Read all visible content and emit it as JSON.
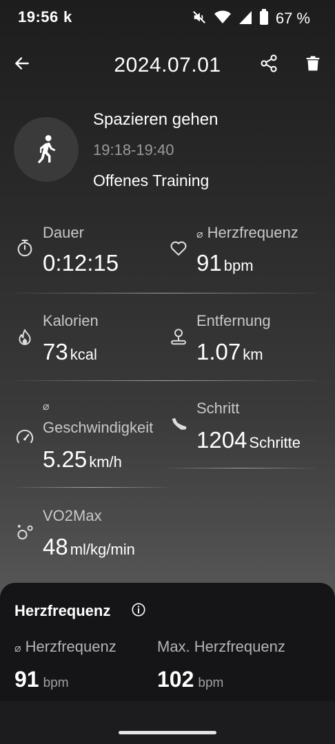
{
  "status": {
    "time": "19:56",
    "app_letter": "k",
    "battery_pct": "67 %"
  },
  "appbar": {
    "title": "2024.07.01"
  },
  "activity": {
    "name": "Spazieren gehen",
    "time_range": "19:18-19:40",
    "type": "Offenes Training"
  },
  "metrics": {
    "duration": {
      "label": "Dauer",
      "value": "0:12:15",
      "unit": ""
    },
    "avg_hr": {
      "label": "Herzfrequenz",
      "prefix": "⌀",
      "value": "91",
      "unit": "bpm"
    },
    "calories": {
      "label": "Kalorien",
      "value": "73",
      "unit": "kcal"
    },
    "distance": {
      "label": "Entfernung",
      "value": "1.07",
      "unit": "km"
    },
    "speed": {
      "prefix": "⌀",
      "label": "Geschwindigkeit",
      "value": "5.25",
      "unit": "km/h"
    },
    "steps": {
      "label": "Schritt",
      "value": "1204",
      "unit": "Schritte"
    },
    "vo2max": {
      "label": "VO2Max",
      "value": "48",
      "unit": "ml/kg/min"
    }
  },
  "heart_rate_card": {
    "title": "Herzfrequenz",
    "avg_prefix": "⌀",
    "avg_label": "Herzfrequenz",
    "max_label": "Max. Herzfrequenz",
    "avg_value": "91",
    "avg_unit": "bpm",
    "max_value": "102",
    "max_unit": "bpm"
  },
  "icons": {
    "back": "arrow-left-icon",
    "share": "share-icon",
    "delete": "trash-icon",
    "activity": "walking-person-icon",
    "duration": "stopwatch-icon",
    "heart": "heart-icon",
    "calories": "flame-icon",
    "distance": "location-pin-icon",
    "speed": "speedometer-icon",
    "steps": "shoe-icon",
    "vo2max": "bubbles-icon",
    "info": "info-icon"
  }
}
